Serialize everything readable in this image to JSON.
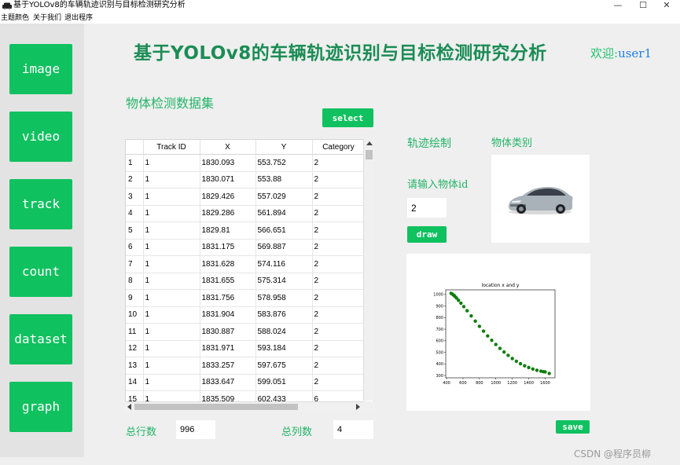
{
  "window": {
    "title": "基于YOLOv8的车辆轨迹识别与目标检测研究分析",
    "minimize": "—",
    "maximize": "☐",
    "close": "✕"
  },
  "menu": [
    "主题颜色",
    "关于我们",
    "退出程序"
  ],
  "sidebar": {
    "items": [
      {
        "label": "image"
      },
      {
        "label": "video"
      },
      {
        "label": "track"
      },
      {
        "label": "count"
      },
      {
        "label": "dataset"
      },
      {
        "label": "graph"
      }
    ]
  },
  "header": {
    "title": "基于YOLOv8的车辆轨迹识别与目标检测研究分析",
    "welcome_label": "欢迎:",
    "username": "user1"
  },
  "dataset": {
    "section_title": "物体检测数据集",
    "select_label": "select",
    "columns": [
      "",
      "Track ID",
      "X",
      "Y",
      "Category"
    ],
    "rows": [
      [
        "1",
        "1",
        "1830.093",
        "553.752",
        "2"
      ],
      [
        "2",
        "1",
        "1830.071",
        "553.88",
        "2"
      ],
      [
        "3",
        "1",
        "1829.426",
        "557.029",
        "2"
      ],
      [
        "4",
        "1",
        "1829.286",
        "561.894",
        "2"
      ],
      [
        "5",
        "1",
        "1829.81",
        "566.651",
        "2"
      ],
      [
        "6",
        "1",
        "1831.175",
        "569.887",
        "2"
      ],
      [
        "7",
        "1",
        "1831.628",
        "574.116",
        "2"
      ],
      [
        "8",
        "1",
        "1831.655",
        "575.314",
        "2"
      ],
      [
        "9",
        "1",
        "1831.756",
        "578.958",
        "2"
      ],
      [
        "10",
        "1",
        "1831.904",
        "583.876",
        "2"
      ],
      [
        "11",
        "1",
        "1830.887",
        "588.024",
        "2"
      ],
      [
        "12",
        "1",
        "1831.971",
        "593.184",
        "2"
      ],
      [
        "13",
        "1",
        "1833.257",
        "597.675",
        "2"
      ],
      [
        "14",
        "1",
        "1833.647",
        "599.051",
        "2"
      ],
      [
        "15",
        "1",
        "1835.509",
        "602.433",
        "6"
      ]
    ],
    "total_rows_label": "总行数",
    "total_rows_value": "996",
    "total_cols_label": "总列数",
    "total_cols_value": "4"
  },
  "trajectory": {
    "section_title": "轨迹绘制",
    "category_title": "物体类别",
    "input_prompt": "请输入物体id",
    "input_value": "2",
    "draw_label": "draw",
    "save_label": "save",
    "category_image": "car-image"
  },
  "chart_data": {
    "type": "scatter",
    "title": "location x and y",
    "xlabel": "",
    "ylabel": "",
    "xlim": [
      390,
      1720
    ],
    "ylim": [
      280,
      1040
    ],
    "xticks": [
      400,
      600,
      800,
      1000,
      1200,
      1400,
      1600
    ],
    "yticks": [
      300,
      400,
      500,
      600,
      700,
      800,
      900,
      1000
    ],
    "color": "#0a7d0a",
    "points": [
      [
        455,
        1010
      ],
      [
        470,
        1003
      ],
      [
        485,
        995
      ],
      [
        500,
        985
      ],
      [
        520,
        970
      ],
      [
        545,
        950
      ],
      [
        575,
        925
      ],
      [
        610,
        895
      ],
      [
        650,
        860
      ],
      [
        700,
        815
      ],
      [
        750,
        770
      ],
      [
        800,
        725
      ],
      [
        850,
        683
      ],
      [
        900,
        642
      ],
      [
        950,
        604
      ],
      [
        1000,
        568
      ],
      [
        1050,
        534
      ],
      [
        1100,
        503
      ],
      [
        1150,
        474
      ],
      [
        1200,
        447
      ],
      [
        1250,
        423
      ],
      [
        1300,
        402
      ],
      [
        1350,
        384
      ],
      [
        1400,
        369
      ],
      [
        1450,
        356
      ],
      [
        1500,
        345
      ],
      [
        1550,
        337
      ],
      [
        1580,
        333
      ],
      [
        1600,
        331
      ],
      [
        1650,
        318
      ]
    ]
  },
  "watermark": "CSDN @程序员柳",
  "colors": {
    "accent": "#10c15f",
    "headline": "#1b8c55",
    "section": "#23b468",
    "username": "#1f7fe0"
  }
}
